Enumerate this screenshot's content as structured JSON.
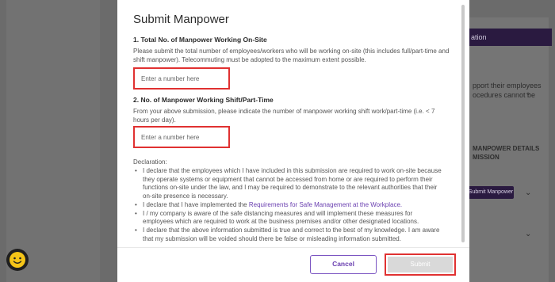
{
  "background": {
    "banner_text": "ation",
    "side_text": "pport their employees\nocedures cannot be",
    "details_text": "MANPOWER DETAILS\nMISSION",
    "submit_manpower_btn": "Submit Manpower"
  },
  "modal": {
    "title": "Submit Manpower",
    "q1": {
      "title": "1. Total No. of Manpower Working On-Site",
      "desc": "Please submit the total number of employees/workers who will be working on-site (this includes full/part-time and shift manpower). Telecommuting must be adopted to the maximum extent possible.",
      "placeholder": "Enter a number here",
      "value": ""
    },
    "q2": {
      "title": "2. No. of Manpower Working Shift/Part-Time",
      "desc": "From your above submission, please indicate the number of manpower working shift work/part-time (i.e. < 7 hours per day).",
      "placeholder": "Enter a number here",
      "value": ""
    },
    "declaration": {
      "title": "Declaration:",
      "items": [
        "I declare that the employees which I have included in this submission are required to work on-site because they operate systems or equipment that cannot be accessed from home or are required to perform their functions on-site under the law, and I may be required to demonstrate to the relevant authorities that their on-site presence is necessary.",
        "I declare that I have implemented the ",
        "I / my company is aware of the safe distancing measures and will implement these measures for employees which are required to work at the business premises and/or other designated locations.",
        "I declare that the above information submitted is true and correct to the best of my knowledge. I am aware that my submission will be voided should there be false or misleading information submitted."
      ],
      "link_text": "Requirements for Safe Management at the Workplace."
    },
    "cancel_label": "Cancel",
    "submit_label": "Submit"
  },
  "colors": {
    "accent": "#6a3fb0",
    "highlight": "#e03131"
  }
}
